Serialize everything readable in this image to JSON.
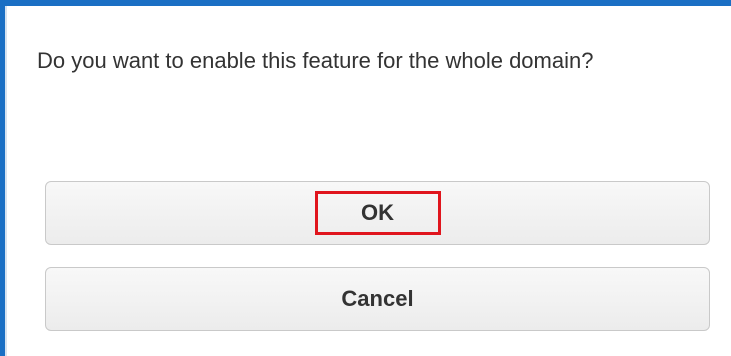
{
  "dialog": {
    "message": "Do you want to enable this feature for the whole domain?",
    "ok_label": "OK",
    "cancel_label": "Cancel"
  },
  "colors": {
    "frame": "#1a6fc4",
    "highlight": "#e0151d",
    "text": "#333333"
  }
}
